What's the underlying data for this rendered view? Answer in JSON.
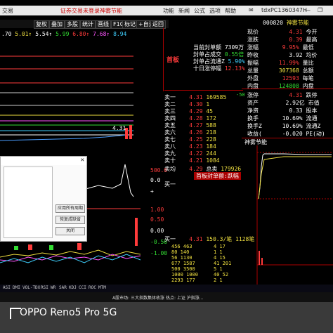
{
  "window": {
    "title_left": "交易",
    "title_center": "证券交易未登录",
    "title_stock": "神雾节能",
    "menu": [
      "功能",
      "新闻",
      "公式",
      "选项",
      "帮助"
    ],
    "account_id": "tdxPC1360347H"
  },
  "toolbar": [
    "复权",
    "叠加",
    "多股",
    "统计",
    "画线",
    "F10",
    "标记",
    "+自选",
    "返回"
  ],
  "price_header": {
    "v1": ".70",
    "v2": "5.01↑",
    "v3": "5.54↑",
    "v4": "5.99",
    "v5": "6.80↑",
    "v6": "7.68↑",
    "v7": "8.94"
  },
  "kline": {
    "last_label": "4.31"
  },
  "board": {
    "label": "首板",
    "rows": [
      {
        "label": "当前封单额",
        "value": "7309万"
      },
      {
        "label": "封单占成交",
        "value": "0.55倍"
      },
      {
        "label": "封单占流通Z",
        "value": "5.90%"
      },
      {
        "label": "十日涨停幅",
        "value": "12.13%"
      }
    ]
  },
  "orderbook": {
    "change_label": "-50",
    "sells": [
      {
        "label": "卖一",
        "price": "4.31",
        "vol": "169585"
      },
      {
        "label": "卖二",
        "price": "4.30",
        "vol": "1"
      },
      {
        "label": "卖三",
        "price": "4.29",
        "vol": "45"
      },
      {
        "label": "卖四",
        "price": "4.28",
        "vol": "172"
      },
      {
        "label": "卖五",
        "price": "4.27",
        "vol": "588"
      },
      {
        "label": "卖六",
        "price": "4.26",
        "vol": "218"
      },
      {
        "label": "卖七",
        "price": "4.25",
        "vol": "228"
      },
      {
        "label": "卖八",
        "price": "4.23",
        "vol": "184"
      },
      {
        "label": "卖九",
        "price": "4.22",
        "vol": "244"
      },
      {
        "label": "卖十",
        "price": "4.21",
        "vol": "1084"
      }
    ],
    "avg_label": "卖均",
    "avg_price": "4.29",
    "total_label": "总卖",
    "total_vol": "179926",
    "buy_label": "买一",
    "buy_price": "4.31",
    "buy_vol": "150.3/笔",
    "buy_count": "1128笔"
  },
  "stock": {
    "code": "000820",
    "name": "神雾节能",
    "quote": [
      {
        "label": "现价",
        "value": "4.31",
        "label2": "今开",
        "value2": ""
      },
      {
        "label": "涨跌",
        "value": "0.39",
        "label2": "最高",
        "value2": ""
      },
      {
        "label": "涨幅",
        "value": "9.95%",
        "label2": "最低",
        "value2": ""
      },
      {
        "label": "昨收",
        "value": "3.92",
        "label2": "均价",
        "value2": ""
      },
      {
        "label": "振幅",
        "value": "11.99%",
        "label2": "量比",
        "value2": ""
      },
      {
        "label": "总量",
        "value": "307368",
        "label2": "总额",
        "value2": ""
      },
      {
        "label": "外盘",
        "value": "12593",
        "label2": "每笔",
        "value2": ""
      },
      {
        "label": "内盘",
        "value": "124808",
        "label2": "内盘",
        "value2": ""
      }
    ],
    "fund": [
      {
        "label": "涨停",
        "value": "4.31",
        "label2": "跌停"
      },
      {
        "label": "资产",
        "value": "2.92亿",
        "label2": "市值"
      },
      {
        "label": "净资",
        "value": "0.33",
        "label2": "股本"
      },
      {
        "label": "换手",
        "value": "10.69%",
        "label2": "流通"
      },
      {
        "label": "换手Z",
        "value": "10.69%",
        "label2": "流通Z"
      },
      {
        "label": "收益(",
        "value": "-0.020",
        "label2": "PE(动)"
      }
    ],
    "mini_chart_title": "神雾节能"
  },
  "vol_axis": [
    "500.0",
    "0.0",
    "+"
  ],
  "kline_axis": [
    "1.00",
    "0.50",
    "0.00",
    "-0.50",
    "-1.00"
  ],
  "dialog": {
    "buttons": [
      "应用所有周期",
      "恢复成缺省",
      "关闭"
    ]
  },
  "seal_banner": "首板封单额:跌幅",
  "indicator_tabs": [
    "ASI",
    "DMI",
    "VOL-TDX",
    "RSI",
    "WR",
    "SAR",
    "KDJ",
    "CCI",
    "ROC",
    "MTM"
  ],
  "status_ticker": "A股市场: 三大指数集体收涨 热点: 上证 沪指涨...",
  "watermark": {
    "brand": "OPPO Reno5 Pro 5G"
  }
}
